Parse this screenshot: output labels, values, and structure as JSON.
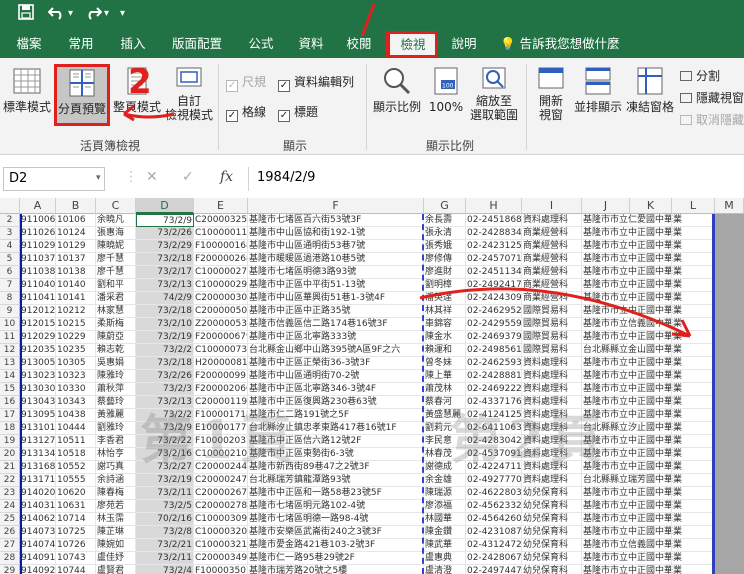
{
  "quick_access": {
    "save_icon": "save-icon",
    "undo_icon": "undo-icon",
    "redo_icon": "redo-icon",
    "customize_icon": "customize-icon"
  },
  "tabs": [
    "檔案",
    "常用",
    "插入",
    "版面配置",
    "公式",
    "資料",
    "校閱",
    "檢視",
    "說明"
  ],
  "active_tab": "檢視",
  "tell_me": "告訴我您想做什麼",
  "ribbon": {
    "workbook_views": {
      "normal": "標準模式",
      "page_break_preview": "分頁預覽",
      "page_layout": "整頁模式",
      "custom_views_line1": "自訂",
      "custom_views_line2": "檢視模式",
      "group_label": "活頁簿檢視"
    },
    "show": {
      "ruler": "尺規",
      "formula_bar": "資料編輯列",
      "gridlines": "格線",
      "headings": "標題",
      "group_label": "顯示"
    },
    "zoom": {
      "zoom": "顯示比例",
      "zoom_100": "100%",
      "zoom_selection_line1": "縮放至",
      "zoom_selection_line2": "選取範圍",
      "group_label": "顯示比例"
    },
    "window": {
      "new_window_line1": "開新",
      "new_window_line2": "視窗",
      "arrange_all": "並排顯示",
      "freeze_panes": "凍結窗格",
      "split": "分割",
      "hide": "隱藏視窗",
      "unhide": "取消隱藏"
    }
  },
  "annotations": {
    "mark1": "1",
    "mark2": "2"
  },
  "formula_bar": {
    "name_box": "D2",
    "cancel": "✕",
    "enter": "✓",
    "fx": "fx",
    "formula": "1984/2/9"
  },
  "columns": [
    "A",
    "B",
    "C",
    "D",
    "E",
    "F",
    "G",
    "H",
    "I",
    "J",
    "K",
    "L",
    "M"
  ],
  "selected_column": "D",
  "watermark": {
    "page1": "第1頁",
    "page2": "第2頁"
  },
  "rows": [
    {
      "n": "2",
      "a": "911006",
      "b": "10106",
      "c": "余曉凡",
      "d": "73/2/9",
      "e": "C200003257",
      "f": "基隆市七堵區百六街53號3F",
      "g": "余長壽",
      "h": "02-24518685",
      "i": "資料處理科",
      "j": "基隆市市立仁愛國中華業"
    },
    {
      "n": "3",
      "a": "911026",
      "b": "10124",
      "c": "張惠海",
      "d": "73/2/26",
      "e": "C100000110",
      "f": "基隆市中山區協和街192-1號",
      "g": "張永清",
      "h": "02-24288344",
      "i": "商業經營科",
      "j": "基隆市市立中正國中華業"
    },
    {
      "n": "4",
      "a": "911029",
      "b": "10129",
      "c": "陳曉妮",
      "d": "73/2/29",
      "e": "F100000168",
      "f": "基隆市中山區通明街53巷7號",
      "g": "張秀娥",
      "h": "02-24231258",
      "i": "商業經營科",
      "j": "基隆市市立中正國中華業"
    },
    {
      "n": "5",
      "a": "911037",
      "b": "10137",
      "c": "廖千慧",
      "d": "73/2/18",
      "e": "F200000268",
      "b2": "",
      "f": "基隆市暖暖區過港路10巷5號",
      "g": "廖修傳",
      "h": "02-24570716",
      "i": "商業經營科",
      "j": "基隆市市立中正國中華業"
    },
    {
      "n": "6",
      "a": "911038",
      "b": "10138",
      "c": "廖千慧",
      "d": "73/2/17",
      "e": "C100000272",
      "f": "基隆市七堵區明德3路93號",
      "g": "廖進財",
      "h": "02-24511340",
      "i": "商業經營科",
      "j": "基隆市市立中正國中華業"
    },
    {
      "n": "7",
      "a": "911040",
      "b": "10140",
      "c": "劉和平",
      "d": "73/2/13",
      "e": "C100000290",
      "f": "基隆市中正區中平街51-13號",
      "g": "劉明樟",
      "h": "02-24924170",
      "i": "商業經營科",
      "j": "基隆市市立中正國中華業"
    },
    {
      "n": "8",
      "a": "911041",
      "b": "10141",
      "c": "潘采君",
      "d": "74/2/9",
      "e": "C200000309",
      "f": "基隆市中山區華興街51巷1-3號4F",
      "g": "潘英達",
      "h": "02-24243092",
      "i": "商業經營科",
      "j": "基隆市市立中正國中華業"
    },
    {
      "n": "9",
      "a": "912012",
      "b": "10212",
      "c": "林家慧",
      "d": "73/2/18",
      "e": "C200000505",
      "f": "基隆市中正區中正路35號",
      "g": "林其祥",
      "h": "02-24629527",
      "i": "國際貿易科",
      "j": "基隆市市立中正國中華業"
    },
    {
      "n": "10",
      "a": "912015",
      "b": "10215",
      "c": "柔斯梅",
      "d": "73/2/10",
      "e": "Z200000535",
      "f": "基隆市信義區信二路174巷16號3F",
      "g": "車錦容",
      "h": "02-24295596",
      "i": "國際貿易科",
      "j": "基隆市市立信義國中華業"
    },
    {
      "n": "11",
      "a": "912029",
      "b": "10229",
      "c": "陳蔚亞",
      "d": "73/2/19",
      "e": "F200000679",
      "f": "基隆市中正區北寧路333號",
      "g": "陳金水",
      "h": "02-24693795",
      "i": "國際貿易科",
      "j": "基隆市市立中正國中華業"
    },
    {
      "n": "12",
      "a": "912035",
      "b": "10235",
      "c": "賴志乾",
      "d": "73/2/2",
      "e": "C100000736",
      "f": "台北縣金山鄉中山路395號A區9F之六",
      "g": "賴運和",
      "h": "02-24985610",
      "i": "國際貿易科",
      "j": "台北縣縣立金山國中華業"
    },
    {
      "n": "13",
      "a": "913005",
      "b": "10305",
      "c": "吳惠娟",
      "d": "73/2/18",
      "e": "H200000813",
      "f": "基隆市中正區正榮街36-3號3F",
      "g": "曾冬妹",
      "h": "02-24625932",
      "i": "資料處理科",
      "j": "基隆市市立中正國中華業"
    },
    {
      "n": "14",
      "a": "913023",
      "b": "10323",
      "c": "陳雅玲",
      "d": "73/2/26",
      "e": "F200000991",
      "f": "基隆市中山區通明街70-2號",
      "g": "陳上華",
      "h": "02-24288811",
      "i": "資料處理科",
      "j": "基隆市市立中正國中華業"
    },
    {
      "n": "15",
      "a": "913030",
      "b": "10330",
      "c": "蕭秋萍",
      "d": "73/2/3",
      "e": "F200002066",
      "f": "基隆市中正區北寧路346-3號4F",
      "g": "蕭茂林",
      "h": "02-24692220",
      "i": "資料處理科",
      "j": "基隆市市立中正國中華業"
    },
    {
      "n": "16",
      "a": "913043",
      "b": "10343",
      "c": "蔡藝玲",
      "d": "73/2/13",
      "e": "C200001199",
      "f": "基隆市中正區復興路230巷63號",
      "g": "蔡春河",
      "h": "02-43371767",
      "i": "資料處理科",
      "j": "基隆市市立中正國中華業"
    },
    {
      "n": "17",
      "a": "913095",
      "b": "10438",
      "c": "黃雅麗",
      "d": "73/2/2",
      "e": "F100001718",
      "f": "基隆市仁二路191號之5F",
      "g": "黃盛慧麗",
      "h": "02-41241255",
      "i": "資料處理科",
      "j": "基隆市市立中正國中華業"
    },
    {
      "n": "18",
      "a": "913101",
      "b": "10444",
      "c": "劉雅玲",
      "d": "73/2/9",
      "e": "E100001771",
      "f": "台北縣汐止鎮忠孝東路417巷16號1F",
      "g": "劉莉元",
      "h": "02-64110635",
      "i": "資料處理科",
      "j": "台北縣縣立汐止國中華業"
    },
    {
      "n": "19",
      "a": "913127",
      "b": "10511",
      "c": "李香君",
      "d": "73/2/22",
      "e": "F100002037",
      "f": "基隆市中正區信六路12號2F",
      "g": "李民意",
      "h": "02-42830427",
      "i": "資料處理科",
      "j": "基隆市市立中正國中華業"
    },
    {
      "n": "20",
      "a": "913134",
      "b": "10518",
      "c": "林怡亨",
      "d": "73/2/16",
      "e": "C100002105",
      "f": "基隆市中正區東勢街6-3號",
      "g": "林春茂",
      "h": "02-45370919",
      "i": "資料處理科",
      "j": "基隆市市立中正國中華業"
    },
    {
      "n": "21",
      "a": "913168",
      "b": "10552",
      "c": "謝巧真",
      "d": "73/2/27",
      "e": "C200002447",
      "f": "基隆市新西街89巷47之2號3F",
      "g": "謝德成",
      "h": "02-42247115",
      "i": "資料處理科",
      "j": "基隆市市立中正國中華業"
    },
    {
      "n": "22",
      "a": "913171",
      "b": "10555",
      "c": "余詩涵",
      "d": "73/2/19",
      "e": "C200002477",
      "f": "台北縣瑞芳鎮龍潭路93號",
      "g": "余金雄",
      "h": "02-49277703",
      "i": "資料處理科",
      "j": "台北縣縣立瑞芳國中華業"
    },
    {
      "n": "23",
      "a": "914020",
      "b": "10620",
      "c": "陳春梅",
      "d": "73/2/11",
      "e": "C200002678",
      "f": "基隆市中正區和一路58巷23號5F",
      "g": "陳瑞源",
      "h": "02-46228033",
      "i": "幼兒保育科",
      "j": "基隆市市立中正國中華業"
    },
    {
      "n": "24",
      "a": "914031",
      "b": "10631",
      "c": "廖苑若",
      "d": "73/2/5",
      "e": "C200002785",
      "f": "基隆市七堵區明元路102-4號",
      "g": "廖添福",
      "h": "02-45623321",
      "i": "幼兒保育科",
      "j": "基隆市市立中正國中華業"
    },
    {
      "n": "25",
      "a": "914062",
      "b": "10714",
      "c": "林玉霈",
      "d": "70/2/16",
      "e": "C100003095",
      "f": "基隆市七堵區明德一路98-4號",
      "g": "林國華",
      "h": "02-45642603",
      "i": "幼兒保育科",
      "j": "基隆市市立中正國中華業"
    },
    {
      "n": "26",
      "a": "914073",
      "b": "10725",
      "c": "陳芷琳",
      "d": "73/2/8",
      "e": "C100003200",
      "f": "基隆市安樂區武崙街240之3號3F",
      "g": "陳金鑽",
      "h": "02-42310872",
      "i": "幼兒保育科",
      "j": "基隆市市立中正國中華業"
    },
    {
      "n": "27",
      "a": "914074",
      "b": "10726",
      "c": "陳婉如",
      "d": "73/2/21",
      "e": "C100003219",
      "f": "基隆市愛金路421巷103-2號3F",
      "g": "陳武華",
      "h": "02-43124728",
      "i": "幼兒保育科",
      "j": "基隆市市立信義國中華業"
    },
    {
      "n": "28",
      "a": "914091",
      "b": "10743",
      "c": "盧佳妤",
      "d": "73/2/11",
      "e": "C200003497",
      "b3": "",
      "f": "基隆市仁一路95巷29號2F",
      "g": "盧惠典",
      "h": "02-24280672",
      "i": "幼兒保育科",
      "j": "基隆市市立中正國中華業"
    },
    {
      "n": "29",
      "a": "914092",
      "b": "10744",
      "c": "盧賢君",
      "d": "73/2/4",
      "e": "F100003507",
      "f": "基隆市瑞芳路20號之5樓",
      "g": "盧清澄",
      "h": "02-24974473",
      "i": "幼兒保育科",
      "j": "基隆市市立中正國中華業"
    }
  ]
}
